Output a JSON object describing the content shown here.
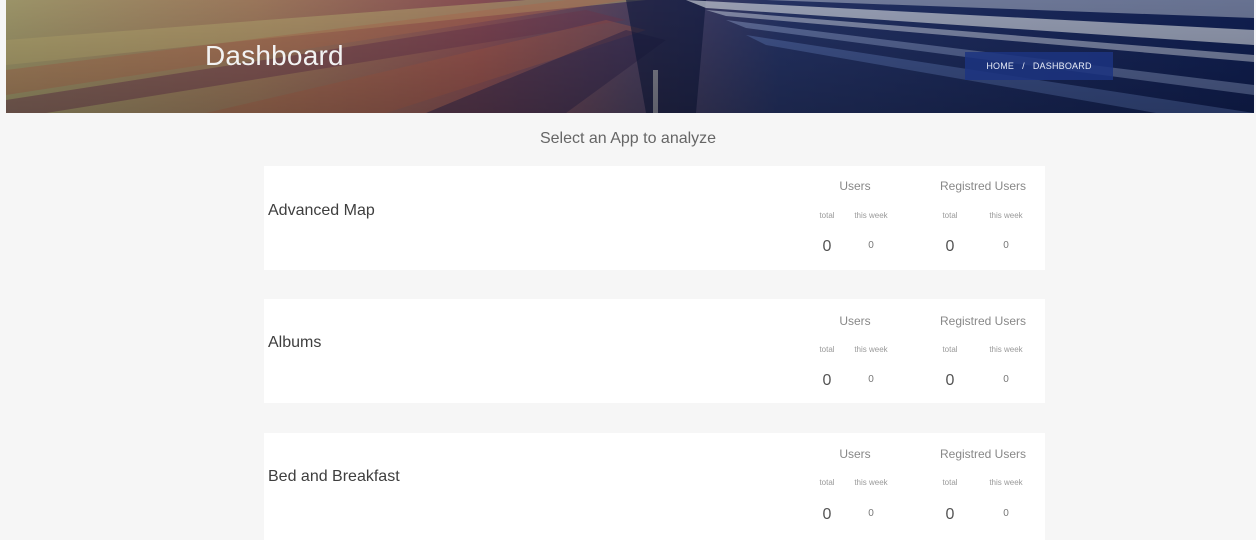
{
  "header": {
    "title": "Dashboard",
    "breadcrumb": {
      "home": "HOME",
      "separator": "/",
      "current": "DASHBOARD"
    }
  },
  "main": {
    "subtitle": "Select an App to analyze",
    "apps": [
      {
        "name": "Advanced Map",
        "users": {
          "title": "Users",
          "total_label": "total",
          "week_label": "this week",
          "total": "0",
          "week": "0"
        },
        "registered": {
          "title": "Registred Users",
          "total_label": "total",
          "week_label": "this week",
          "total": "0",
          "week": "0"
        }
      },
      {
        "name": "Albums",
        "users": {
          "title": "Users",
          "total_label": "total",
          "week_label": "this week",
          "total": "0",
          "week": "0"
        },
        "registered": {
          "title": "Registred Users",
          "total_label": "total",
          "week_label": "this week",
          "total": "0",
          "week": "0"
        }
      },
      {
        "name": "Bed and Breakfast",
        "users": {
          "title": "Users",
          "total_label": "total",
          "week_label": "this week",
          "total": "0",
          "week": "0"
        },
        "registered": {
          "title": "Registred Users",
          "total_label": "total",
          "week_label": "this week",
          "total": "0",
          "week": "0"
        }
      }
    ]
  },
  "colors": {
    "background": "#f6f6f6",
    "card": "#ffffff",
    "breadcrumb_bg": "#1c3480"
  }
}
